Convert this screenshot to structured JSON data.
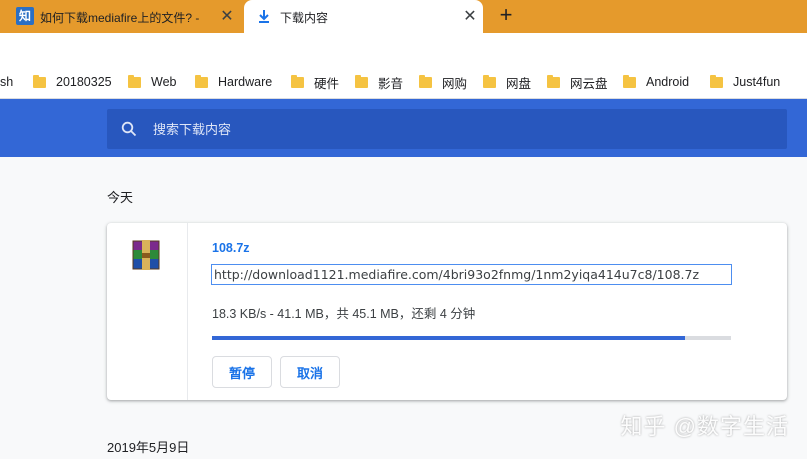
{
  "tabs": [
    {
      "title": "如何下载mediafire上的文件? - ",
      "favicon_text": "知",
      "active": false
    },
    {
      "title": "下载内容",
      "active": true
    }
  ],
  "new_tab_symbol": "+",
  "close_symbol": "✕",
  "bookmarks": [
    {
      "label": "sh"
    },
    {
      "label": "20180325"
    },
    {
      "label": "Web"
    },
    {
      "label": "Hardware"
    },
    {
      "label": "硬件"
    },
    {
      "label": "影音"
    },
    {
      "label": "网购"
    },
    {
      "label": "网盘"
    },
    {
      "label": "网云盘"
    },
    {
      "label": "Android"
    },
    {
      "label": "Just4fun"
    }
  ],
  "search": {
    "placeholder": "搜索下载内容",
    "value": ""
  },
  "sections": {
    "today_label": "今天",
    "older_label": "2019年5月9日"
  },
  "download": {
    "file_name": "108.7z",
    "url": "http://download1121.mediafire.com/4bri93o2fnmg/1nm2yiqa414u7c8/108.7z",
    "status": "18.3 KB/s - 41.1 MB，共 45.1 MB，还剩 4 分钟",
    "progress_fraction": 0.911,
    "pause_label": "暂停",
    "cancel_label": "取消"
  },
  "watermark": "知乎 @数字生活",
  "colors": {
    "tab_strip": "#e59a2c",
    "header": "#3367d6",
    "search_bg": "#2857be",
    "link": "#1a73e8",
    "progress": "#3367d6"
  }
}
